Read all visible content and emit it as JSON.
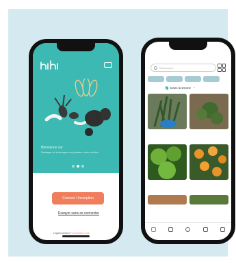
{
  "welcome_screen": {
    "logo_text": "hihi",
    "logo_subtitle": "",
    "tagline_title": "Bienvenue sur",
    "tagline_body": "Partagez et échangez vos plantes entre voisins",
    "cta_label": "Connect / Inscription",
    "secondary_link": "Essayer sans se connecter",
    "legal_prefix": "Légal invention ?",
    "legal_link": "Connectez vous",
    "colors": {
      "teal": "#3bb9b2",
      "coral": "#f07e5d"
    }
  },
  "feed_screen": {
    "search_placeholder": "Rechercher",
    "chips": [
      "",
      "",
      "",
      ""
    ],
    "location_filter": "Dans la Drome",
    "cards": [
      {
        "title": "",
        "location": ""
      },
      {
        "title": "",
        "location": ""
      },
      {
        "title": "",
        "location": ""
      },
      {
        "title": "",
        "location": ""
      },
      {
        "title": "",
        "location": ""
      },
      {
        "title": "",
        "location": ""
      }
    ],
    "nav": [
      "home-icon",
      "search-icon",
      "add-icon",
      "message-icon",
      "profile-icon"
    ]
  }
}
